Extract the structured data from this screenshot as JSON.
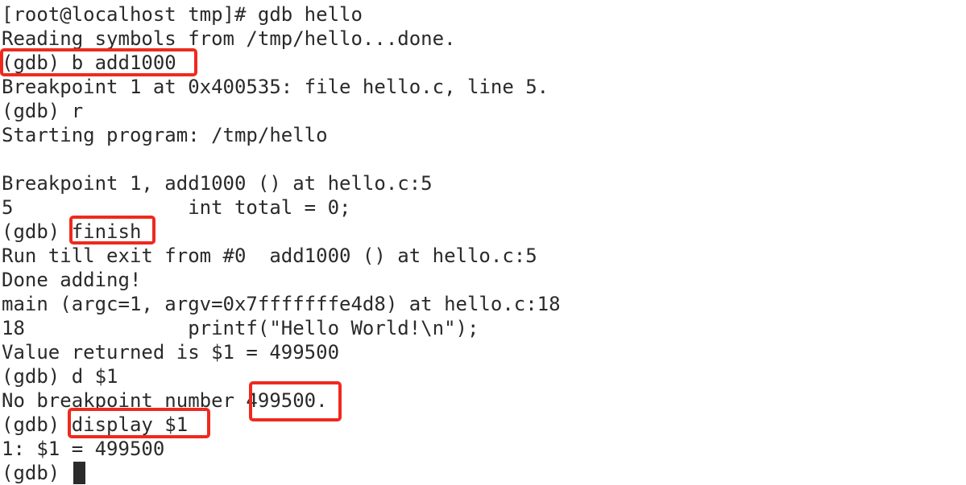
{
  "terminal": {
    "lines": [
      "[root@localhost tmp]# gdb hello",
      "Reading symbols from /tmp/hello...done.",
      "(gdb) b add1000",
      "Breakpoint 1 at 0x400535: file hello.c, line 5.",
      "(gdb) r",
      "Starting program: /tmp/hello",
      "",
      "Breakpoint 1, add1000 () at hello.c:5",
      "5               int total = 0;",
      "(gdb) finish",
      "Run till exit from #0  add1000 () at hello.c:5",
      "Done adding!",
      "main (argc=1, argv=0x7fffffffe4d8) at hello.c:18",
      "18              printf(\"Hello World!\\n\");",
      "Value returned is $1 = 499500",
      "(gdb) d $1",
      "No breakpoint number 499500.",
      "(gdb) display $1",
      "1: $1 = 499500",
      "(gdb) "
    ],
    "highlight_color": "#ee2a1e",
    "highlighted_snippets": [
      "(gdb) b add1000",
      "finish",
      "499500.",
      "display $1"
    ]
  }
}
